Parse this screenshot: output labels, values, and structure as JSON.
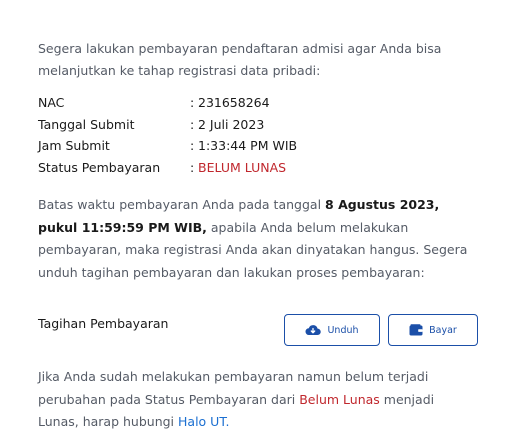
{
  "intro": "Segera lakukan pembayaran pendaftaran admisi agar Anda bisa melanjutkan ke tahap registrasi data pribadi:",
  "info": [
    {
      "label": "NAC",
      "sep": ":",
      "value": "231658264"
    },
    {
      "label": "Tanggal Submit",
      "sep": ":",
      "value": "2 Juli 2023"
    },
    {
      "label": "Jam Submit",
      "sep": ":",
      "value": "1:33:44 PM WIB"
    },
    {
      "label": "Status Pembayaran",
      "sep": ":",
      "value": "BELUM LUNAS"
    }
  ],
  "note": {
    "before": "Batas waktu pembayaran Anda pada tanggal ",
    "deadline": "8 Agustus 2023, pukul 11:59:59 PM WIB,",
    "after": " apabila Anda belum melakukan pembayaran, maka registrasi Anda akan dinyatakan hangus. Segera unduh tagihan pembayaran dan lakukan proses pembayaran:"
  },
  "bill": {
    "label": "Tagihan Pembayaran",
    "download_label": "Unduh",
    "pay_label": "Bayar"
  },
  "footer": {
    "before": "Jika Anda sudah melakukan pembayaran namun belum terjadi perubahan pada Status Pembayaran dari ",
    "status": "Belum Lunas",
    "middle": " menjadi Lunas, harap hubungi ",
    "link": "Halo UT."
  },
  "colors": {
    "accent": "#1b4fa8",
    "status_unpaid": "#c0272d",
    "link": "#1b6fd1"
  },
  "icons": {
    "download": "cloud-download-icon",
    "pay": "wallet-icon"
  }
}
